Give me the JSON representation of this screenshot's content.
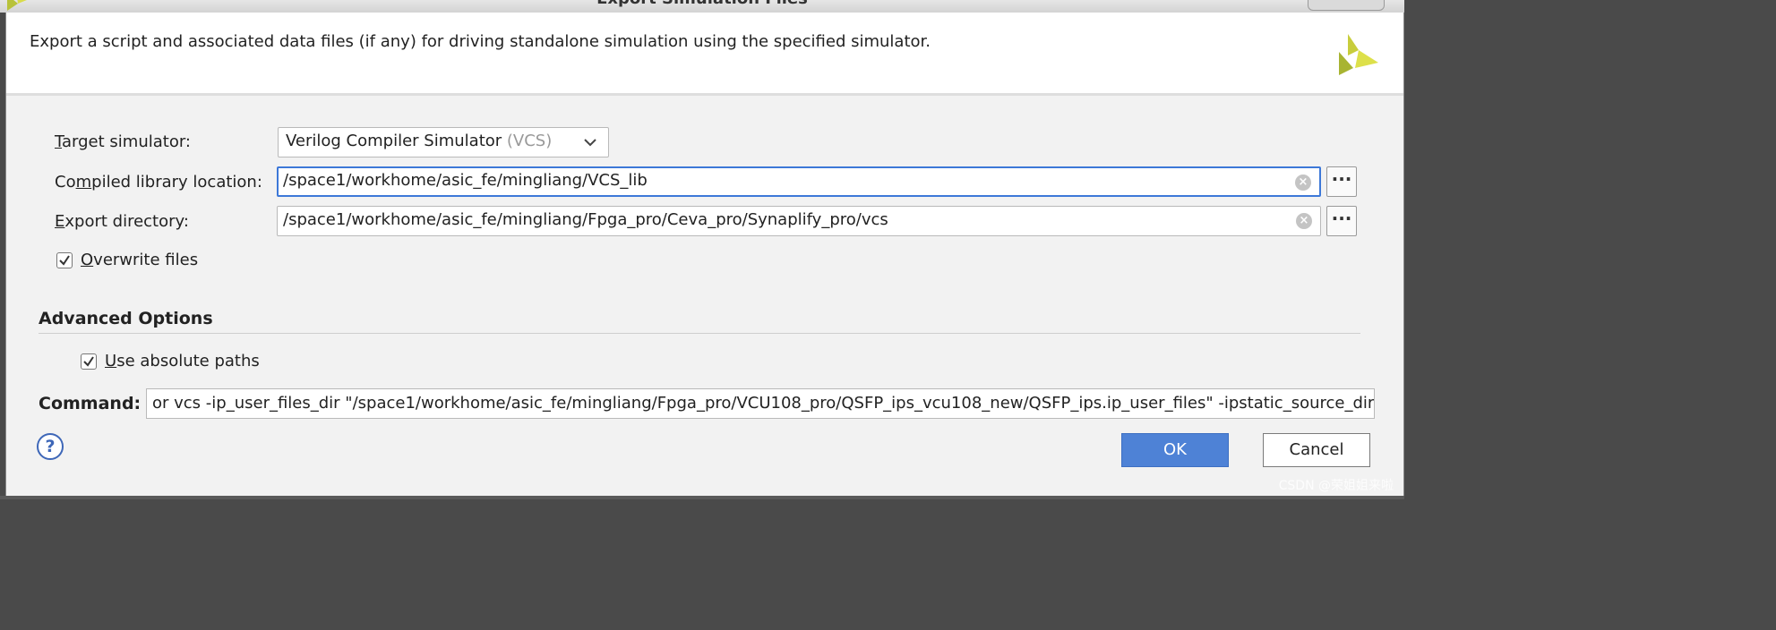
{
  "window": {
    "title": "Export Simulation Files"
  },
  "header": {
    "description": "Export a script and associated data files (if any) for driving standalone simulation using the specified simulator.",
    "logo_icon": "xilinx-vivado-logo"
  },
  "form": {
    "target_simulator": {
      "label_mnemonic": "T",
      "label_rest": "arget simulator:",
      "value_main": "Verilog Compiler Simulator",
      "value_suffix": "(VCS)"
    },
    "compiled_library": {
      "label_pre": "Co",
      "label_mnemonic": "m",
      "label_rest": "piled library location:",
      "value": "/space1/workhome/asic_fe/mingliang/VCS_lib",
      "browse_label": "···"
    },
    "export_directory": {
      "label_mnemonic": "E",
      "label_rest": "xport directory:",
      "value": "/space1/workhome/asic_fe/mingliang/Fpga_pro/Ceva_pro/Synaplify_pro/vcs",
      "browse_label": "···"
    },
    "overwrite_files": {
      "label_mnemonic": "O",
      "label_rest": "verwrite files",
      "checked": true
    }
  },
  "advanced": {
    "title": "Advanced Options",
    "use_absolute_paths": {
      "label_mnemonic": "U",
      "label_rest": "se absolute paths",
      "checked": true
    }
  },
  "command": {
    "label": "Command:",
    "value": "or vcs  -ip_user_files_dir \"/space1/workhome/asic_fe/mingliang/Fpga_pro/VCU108_pro/QSFP_ips_vcu108_new/QSFP_ips.ip_user_files\" -ipstatic_source_dir"
  },
  "footer": {
    "help_label": "?",
    "ok_label": "OK",
    "cancel_label": "Cancel"
  },
  "watermark": "CSDN @荣姐姐来啦",
  "colors": {
    "accent_blue": "#4e82d6",
    "focus_border": "#3d78d8",
    "logo_olive": "#a8b432",
    "logo_yellow": "#dde04a"
  }
}
